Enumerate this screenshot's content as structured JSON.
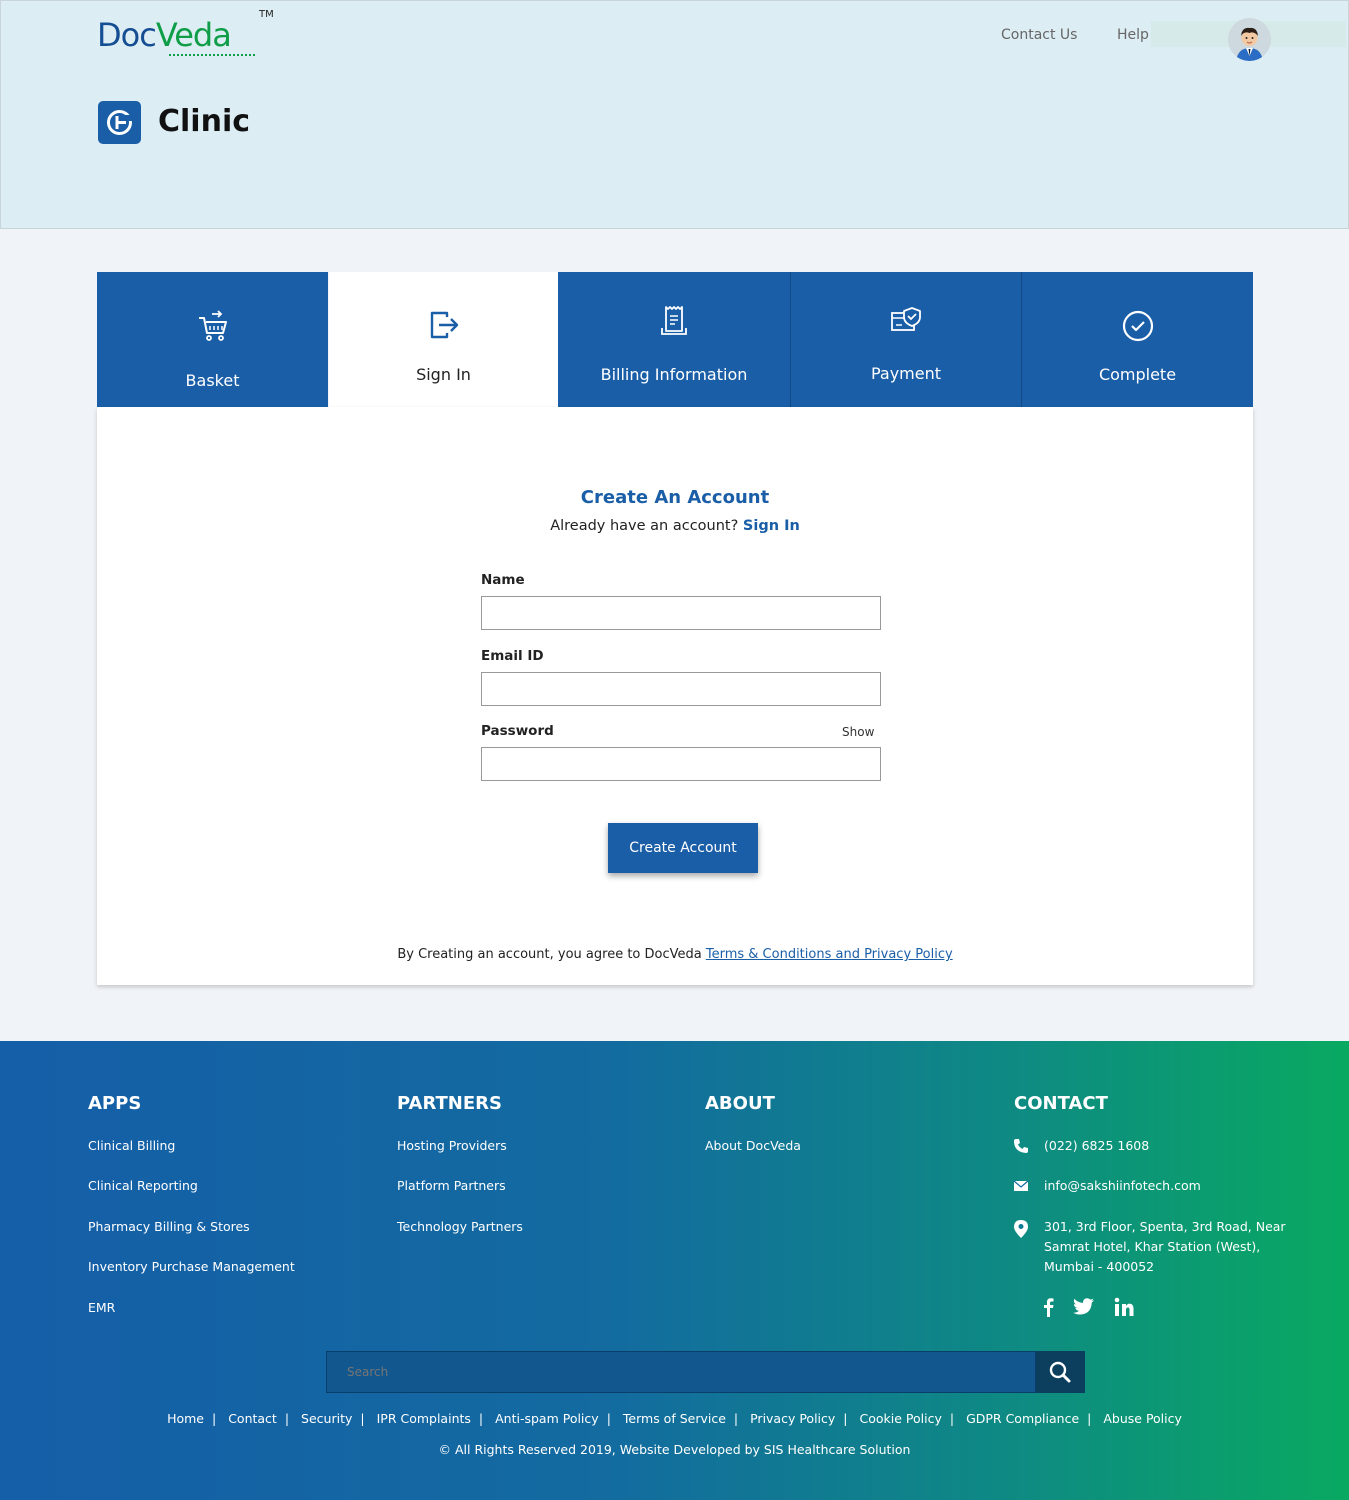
{
  "header": {
    "logo_text_a": "Doc",
    "logo_text_b": "Veda",
    "logo_tm": "TM",
    "nav": {
      "contact": "Contact Us",
      "help": "Help"
    },
    "page_title": "Clinic"
  },
  "steps": [
    {
      "label": "Basket",
      "icon": "cart-icon"
    },
    {
      "label": "Sign In",
      "icon": "sign-in-icon"
    },
    {
      "label": "Billing Information",
      "icon": "receipt-icon"
    },
    {
      "label": "Payment",
      "icon": "payment-card-icon"
    },
    {
      "label": "Complete",
      "icon": "check-circle-icon"
    }
  ],
  "form": {
    "title": "Create An Account",
    "subtitle": "Already have an account?",
    "signin_link": "Sign In",
    "name_label": "Name",
    "name_value": "",
    "email_label": "Email ID",
    "email_value": "",
    "password_label": "Password",
    "password_value": "",
    "show_label": "Show",
    "submit_label": "Create Account",
    "terms_text": "By Creating an account, you agree to DocVeda",
    "terms_link": "Terms & Conditions and Privacy Policy"
  },
  "footer": {
    "apps": {
      "title": "APPS",
      "items": [
        "Clinical Billing",
        "Clinical Reporting",
        "Pharmacy Billing & Stores",
        "Inventory Purchase Management",
        "EMR"
      ]
    },
    "partners": {
      "title": "PARTNERS",
      "items": [
        "Hosting Providers",
        "Platform Partners",
        "Technology Partners"
      ]
    },
    "about": {
      "title": "ABOUT",
      "items": [
        "About DocVeda"
      ]
    },
    "contact": {
      "title": "CONTACT",
      "phone": "(022) 6825 1608",
      "email": "info@sakshiinfotech.com",
      "address_1": "301, 3rd Floor, Spenta, 3rd Road, Near",
      "address_2": "Samrat Hotel, Khar Station (West),",
      "address_3": "Mumbai - 400052"
    },
    "social": [
      "facebook-icon",
      "twitter-icon",
      "linkedin-icon"
    ],
    "search_placeholder": "Search",
    "bottom_links": [
      "Home",
      "Contact",
      "Security",
      "IPR Complaints",
      "Anti-spam Policy",
      "Terms of Service",
      "Privacy Policy",
      "Cookie Policy",
      "GDPR Compliance",
      "Abuse Policy"
    ],
    "copyright": "© All Rights Reserved 2019, Website Developed by SIS Healthcare Solution"
  },
  "colors": {
    "primary": "#1a5ea7",
    "brand_green": "#0f9e47",
    "header_bg": "#ddedf4",
    "footer_gradient_start": "#155ea8",
    "footer_gradient_end": "#09a961"
  }
}
